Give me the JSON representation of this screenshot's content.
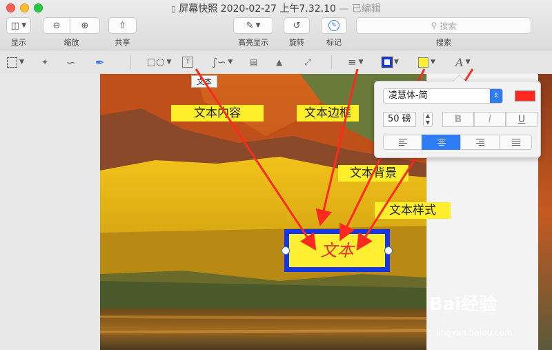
{
  "window": {
    "title": "屏幕快照 2020-02-27 上午7.32.10",
    "title_suffix": "— 已编辑"
  },
  "toolbar": {
    "view_label": "显示",
    "zoom_label": "缩放",
    "share_label": "共享",
    "highlight_label": "高亮显示",
    "rotate_label": "旋转",
    "markup_label": "标记",
    "search_label": "搜索",
    "search_placeholder": "搜索"
  },
  "markup_tools": {
    "text_tooltip": "文本"
  },
  "annotations": {
    "text_content": "文本内容",
    "text_border": "文本边框",
    "text_background": "文本背景",
    "text_style": "文本样式",
    "text_box_value": "文本"
  },
  "font_popover": {
    "font_name": "凌慧体-简",
    "font_size": "50 磅",
    "bold": "B",
    "italic": "I",
    "underline": "U",
    "text_color": "#ff2a1f"
  },
  "colors": {
    "border_color": "#1436e6",
    "fill_color": "#ffef33",
    "callout_bg": "#ffef2a",
    "arrow_color": "#ff2a1f"
  },
  "watermark": {
    "brand": "Bai经验",
    "url": "jingyan.baidu.com"
  }
}
